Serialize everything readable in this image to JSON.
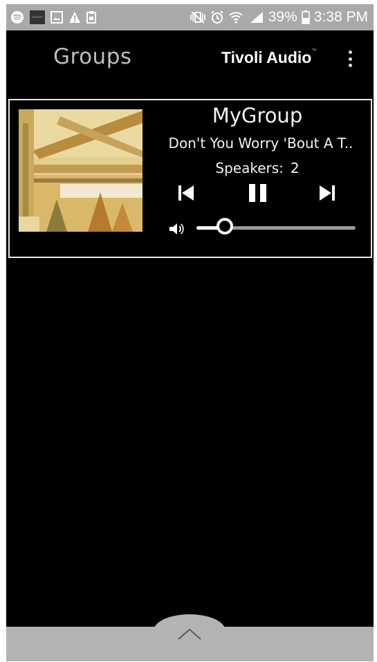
{
  "status_bar": {
    "battery_percent": "39%",
    "time": "3:38 PM",
    "left_icons": [
      "spotify-icon",
      "album-thumb-icon",
      "image-icon",
      "warning-icon",
      "clipboard-icon"
    ],
    "right_icons": [
      "mute-vibrate-icon",
      "alarm-icon",
      "wifi-icon",
      "signal-icon",
      "battery-icon"
    ]
  },
  "app_bar": {
    "title": "Groups",
    "brand": "Tivoli Audio",
    "brand_tm": "™",
    "menu_icon": "more-vert-icon"
  },
  "group": {
    "name": "MyGroup",
    "track": "Don't You Worry 'Bout A T..",
    "speakers_label": "Speakers:",
    "speakers_count": "2",
    "volume_level": 0.18,
    "controls": [
      "skip-previous-icon",
      "pause-icon",
      "skip-next-icon"
    ],
    "volume_icon": "volume-icon"
  },
  "bottom_bar": {
    "icon": "chevron-up-icon"
  },
  "colors": {
    "background": "#000000",
    "status_bar": "#a9a9a9",
    "title_gray": "#bfbfbf",
    "bottom_bar": "#b3b3b3",
    "card_border": "#e8e8e8"
  }
}
